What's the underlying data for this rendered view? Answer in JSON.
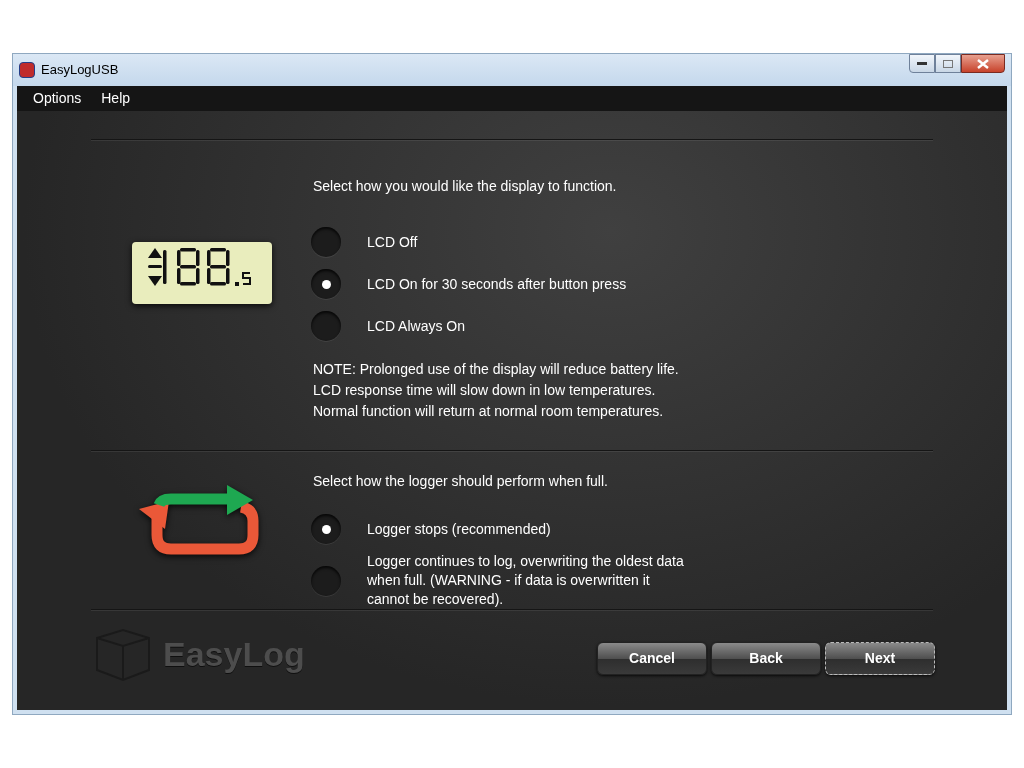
{
  "window": {
    "title": "EasyLogUSB"
  },
  "menu": [
    "Options",
    "Help"
  ],
  "display_section": {
    "heading": "Select how you would like the display to function.",
    "options": [
      {
        "label": "LCD Off",
        "selected": false
      },
      {
        "label": "LCD On for 30 seconds after button press",
        "selected": true
      },
      {
        "label": "LCD Always On",
        "selected": false
      }
    ],
    "note": [
      "NOTE: Prolonged use of the display will reduce battery life.",
      "LCD response time will slow down in low temperatures.",
      "Normal function will return at normal room temperatures."
    ]
  },
  "full_section": {
    "heading": "Select how the logger should perform when full.",
    "options": [
      {
        "label": "Logger stops (recommended)",
        "selected": true
      },
      {
        "label": "Logger continues to log, overwriting the oldest data when full. (WARNING - if data is overwritten it cannot be recovered).",
        "selected": false
      }
    ]
  },
  "logo": {
    "text": "EasyLog"
  },
  "buttons": [
    {
      "label": "Cancel",
      "focused": false
    },
    {
      "label": "Back",
      "focused": false
    },
    {
      "label": "Next",
      "focused": true
    }
  ]
}
